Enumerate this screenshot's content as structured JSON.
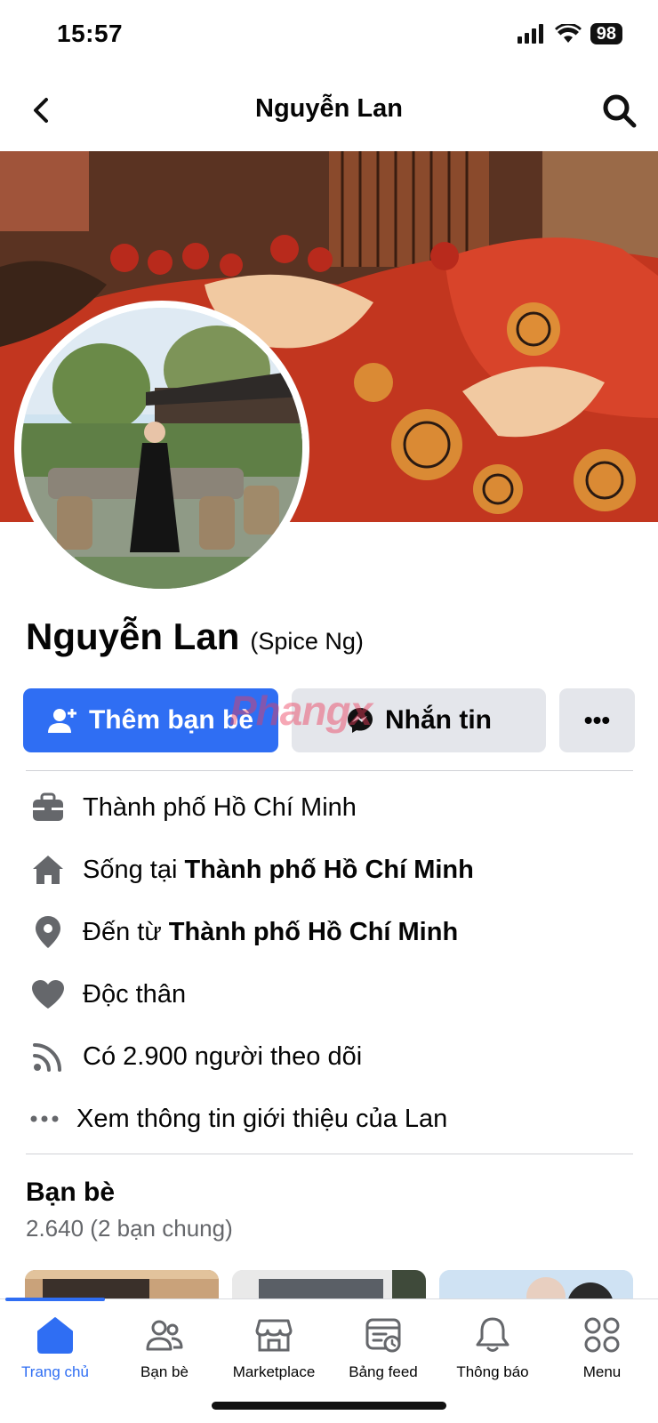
{
  "status_bar": {
    "time": "15:57",
    "battery": "98"
  },
  "header": {
    "title": "Nguyễn Lan"
  },
  "profile": {
    "name": "Nguyễn Lan",
    "alt_name": "(Spice Ng)"
  },
  "actions": {
    "add_friend": "Thêm bạn bè",
    "message": "Nhắn tin",
    "more": "•••"
  },
  "intro": {
    "work": "Thành phố Hồ Chí Minh",
    "lives_prefix": "Sống tại ",
    "lives_place": "Thành phố Hồ Chí Minh",
    "from_prefix": "Đến từ ",
    "from_place": "Thành phố Hồ Chí Minh",
    "relationship": "Độc thân",
    "followers": "Có 2.900 người theo dõi",
    "see_more": "Xem thông tin giới thiệu của Lan"
  },
  "friends": {
    "title": "Bạn bè",
    "count": "2.640 (2 bạn chung)"
  },
  "tabs": [
    {
      "label": "Trang chủ",
      "icon": "home-icon",
      "active": true
    },
    {
      "label": "Bạn bè",
      "icon": "friends-icon"
    },
    {
      "label": "Marketplace",
      "icon": "marketplace-icon"
    },
    {
      "label": "Bảng feed",
      "icon": "feed-icon"
    },
    {
      "label": "Thông báo",
      "icon": "bell-icon"
    },
    {
      "label": "Menu",
      "icon": "menu-grid-icon"
    }
  ],
  "watermark": "Phangx",
  "colors": {
    "accent": "#2f6ef3",
    "secondary_button": "#e4e6eb",
    "muted_text": "#65676b"
  }
}
